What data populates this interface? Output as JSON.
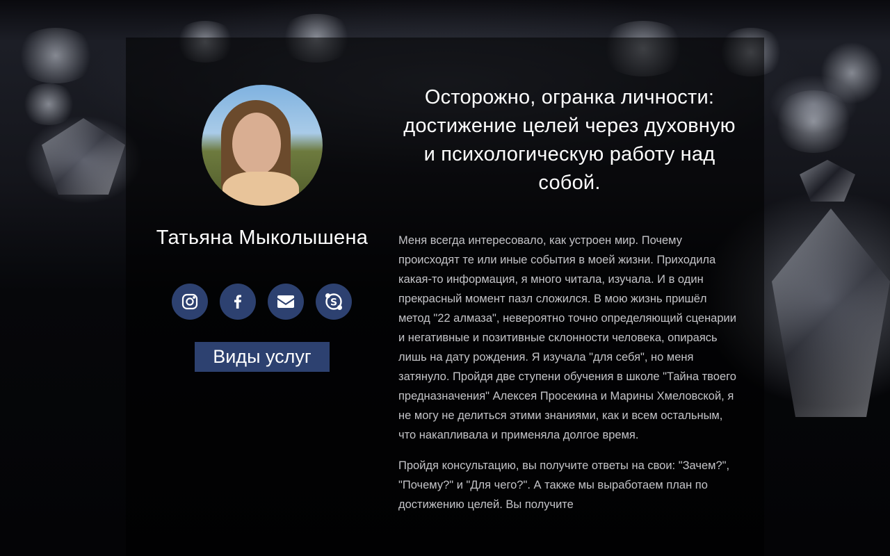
{
  "profile": {
    "name": "Татьяна Мыколышена",
    "avatar_alt": "profile-photo"
  },
  "socials": [
    {
      "icon": "instagram-icon"
    },
    {
      "icon": "facebook-icon"
    },
    {
      "icon": "email-icon"
    },
    {
      "icon": "skype-icon"
    }
  ],
  "services_button": {
    "label": "Виды услуг"
  },
  "content": {
    "headline": "Осторожно, огранка личности: достижение целей через духовную и психологическую работу над собой.",
    "paragraph1": "Меня всегда интересовало, как устроен мир. Почему происходят те или иные события в моей жизни. Приходила какая-то информация, я много читала, изучала. И в один прекрасный момент пазл сложился. В мою жизнь пришёл метод \"22 алмаза\", невероятно точно определяющий сценарии и негативные и позитивные склонности человека, опираясь лишь на дату рождения. Я изучала \"для себя\", но меня затянуло. Пройдя две ступени обучения в школе \"Тайна твоего предназначения\" Алексея Просекина и Марины Хмеловской, я не могу не делиться этими знаниями, как и всем остальным, что накапливала и применяла долгое время.",
    "paragraph2": "Пройдя консультацию, вы получите ответы на свои: \"Зачем?\", \"Почему?\" и \"Для чего?\". А также мы выработаем план по достижению целей. Вы получите"
  },
  "colors": {
    "accent": "#2d4170",
    "text_primary": "#ffffff",
    "text_body": "#c4c4c8"
  }
}
